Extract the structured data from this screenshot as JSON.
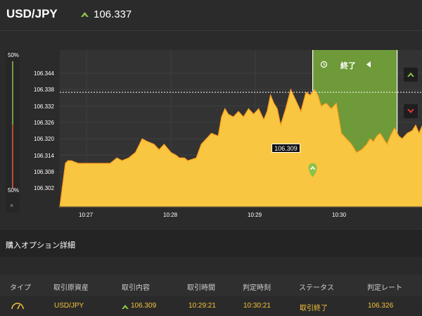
{
  "header": {
    "pair": "USD/JPY",
    "price": "106.337",
    "arrow_icon": "up-arrow-icon",
    "arrow_color": "#8bc34a"
  },
  "chart": {
    "side_top_pct": "50%",
    "side_bottom_pct": "50%",
    "side_close": "×",
    "end_label": "終了",
    "entry_tag": "106.309",
    "colors": {
      "area": "#f8c640",
      "area_stroke": "#ff9d1c",
      "expiry_zone": "#6e9a39",
      "up": "#8bc34a",
      "down": "#e74c3c"
    },
    "y_ticks": [
      "106.344",
      "106.338",
      "106.332",
      "106.326",
      "106.320",
      "106.314",
      "106.308",
      "106.302"
    ],
    "x_ticks": [
      "10:27",
      "10:28",
      "10:29",
      "10:30"
    ]
  },
  "section": {
    "title": "購入オプション詳細"
  },
  "table": {
    "headers": [
      "タイプ",
      "取引原資産",
      "取引内容",
      "取引時間",
      "判定時刻",
      "ステータス",
      "判定レート"
    ],
    "row": {
      "type_icon": "gauge-icon",
      "asset": "USD/JPY",
      "direction_icon": "up-arrow-icon",
      "content": "106.309",
      "trade_time": "10:29:21",
      "judge_time": "10:30:21",
      "status": "取引終了",
      "rate": "106.326"
    }
  },
  "chart_data": {
    "type": "area",
    "x_unit": "minutes after 10:27",
    "x": [
      -0.25,
      -0.22,
      -0.18,
      -0.1,
      0,
      0.1,
      0.2,
      0.28,
      0.32,
      0.36,
      0.42,
      0.5,
      0.58,
      0.66,
      0.72,
      0.8,
      0.86,
      0.92,
      1.0,
      1.06,
      1.1,
      1.16,
      1.2,
      1.3,
      1.36,
      1.42,
      1.48,
      1.56,
      1.6,
      1.64,
      1.68,
      1.74,
      1.8,
      1.86,
      1.92,
      1.98,
      2.04,
      2.1,
      2.14,
      2.18,
      2.22,
      2.26,
      2.3,
      2.36,
      2.42,
      2.48,
      2.54,
      2.6,
      2.65,
      2.7,
      2.74,
      2.78,
      2.84,
      2.9,
      2.96,
      3.02,
      3.08,
      3.14,
      3.2,
      3.26,
      3.32,
      3.36,
      3.4,
      3.44,
      3.48,
      3.52,
      3.56,
      3.6,
      3.65,
      3.7,
      3.74,
      3.8,
      3.86,
      3.9,
      3.94,
      3.98,
      4.03,
      4.08,
      4.12,
      4.16,
      4.2,
      4.24,
      4.28,
      4.32
    ],
    "y": [
      106.311,
      106.312,
      106.312,
      106.311,
      106.311,
      106.311,
      106.311,
      106.311,
      106.312,
      106.313,
      106.312,
      106.313,
      106.315,
      106.32,
      106.319,
      106.318,
      106.316,
      106.318,
      106.315,
      106.314,
      106.313,
      106.313,
      106.312,
      106.313,
      106.318,
      106.32,
      106.322,
      106.321,
      106.328,
      106.331,
      106.329,
      106.328,
      106.33,
      106.328,
      106.331,
      106.329,
      106.331,
      106.327,
      106.33,
      106.336,
      106.333,
      106.331,
      106.325,
      106.331,
      106.338,
      106.334,
      106.33,
      106.337,
      106.336,
      106.338,
      106.336,
      106.332,
      106.333,
      106.331,
      106.333,
      106.322,
      106.32,
      106.318,
      106.315,
      106.316,
      106.318,
      106.32,
      106.319,
      106.321,
      106.322,
      106.32,
      106.318,
      106.321,
      106.324,
      106.321,
      106.32,
      106.322,
      106.323,
      106.325,
      106.322,
      106.325,
      106.321,
      106.323,
      106.326,
      106.324,
      106.336,
      106.332,
      106.339,
      106.337
    ],
    "entry": {
      "x": 2.68,
      "y": 106.309
    },
    "expiry_zone": {
      "x0": 2.68,
      "x1": 3.68
    },
    "current_rate": 106.337,
    "ylim": [
      106.297,
      106.35
    ],
    "xlim": [
      -0.25,
      4.25
    ],
    "grid": true
  }
}
